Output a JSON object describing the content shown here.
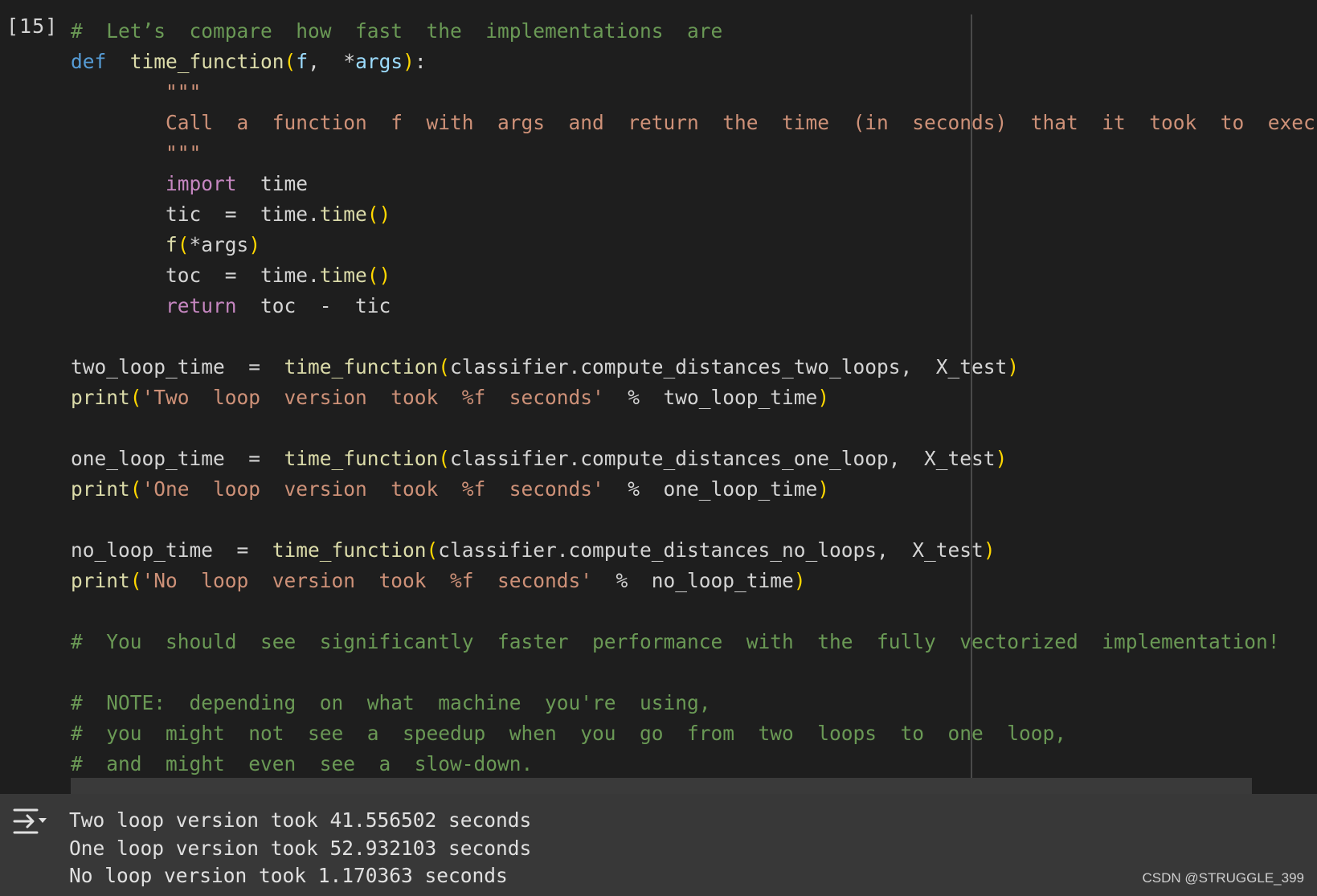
{
  "cell": {
    "execution_count": "[15]",
    "code_lines": [
      [
        [
          "cm",
          "#  Let’s  compare  how  fast  the  implementations  are"
        ]
      ],
      [
        [
          "kw",
          "def"
        ],
        [
          "t",
          "  "
        ],
        [
          "fn",
          "time_function"
        ],
        [
          "br",
          "("
        ],
        [
          "var",
          "f"
        ],
        [
          "t",
          ",  "
        ],
        [
          "t",
          "*"
        ],
        [
          "var",
          "args"
        ],
        [
          "br",
          ")"
        ],
        [
          "t",
          ":"
        ]
      ],
      [
        [
          "t",
          "        "
        ],
        [
          "str",
          "\"\"\""
        ]
      ],
      [
        [
          "t",
          "        "
        ],
        [
          "str",
          "Call  a  function  f  with  args  and  return  the  time  (in  seconds)  that  it  took  to  execute."
        ]
      ],
      [
        [
          "t",
          "        "
        ],
        [
          "str",
          "\"\"\""
        ]
      ],
      [
        [
          "t",
          "        "
        ],
        [
          "kw2",
          "import"
        ],
        [
          "t",
          "  time"
        ]
      ],
      [
        [
          "t",
          "        tic  =  time."
        ],
        [
          "fn",
          "time"
        ],
        [
          "br",
          "()"
        ]
      ],
      [
        [
          "t",
          "        "
        ],
        [
          "fn",
          "f"
        ],
        [
          "br",
          "("
        ],
        [
          "t",
          "*args"
        ],
        [
          "br",
          ")"
        ]
      ],
      [
        [
          "t",
          "        toc  =  time."
        ],
        [
          "fn",
          "time"
        ],
        [
          "br",
          "()"
        ]
      ],
      [
        [
          "t",
          "        "
        ],
        [
          "kw2",
          "return"
        ],
        [
          "t",
          "  toc  -  tic"
        ]
      ],
      [
        [
          "t",
          ""
        ]
      ],
      [
        [
          "t",
          "two_loop_time  =  "
        ],
        [
          "fn",
          "time_function"
        ],
        [
          "br",
          "("
        ],
        [
          "t",
          "classifier.compute_distances_two_loops,  X_test"
        ],
        [
          "br",
          ")"
        ]
      ],
      [
        [
          "fn",
          "print"
        ],
        [
          "br",
          "("
        ],
        [
          "str",
          "'Two  loop  version  took  %f  seconds'"
        ],
        [
          "t",
          "  %  two_loop_time"
        ],
        [
          "br",
          ")"
        ]
      ],
      [
        [
          "t",
          ""
        ]
      ],
      [
        [
          "t",
          "one_loop_time  =  "
        ],
        [
          "fn",
          "time_function"
        ],
        [
          "br",
          "("
        ],
        [
          "t",
          "classifier.compute_distances_one_loop,  X_test"
        ],
        [
          "br",
          ")"
        ]
      ],
      [
        [
          "fn",
          "print"
        ],
        [
          "br",
          "("
        ],
        [
          "str",
          "'One  loop  version  took  %f  seconds'"
        ],
        [
          "t",
          "  %  one_loop_time"
        ],
        [
          "br",
          ")"
        ]
      ],
      [
        [
          "t",
          ""
        ]
      ],
      [
        [
          "t",
          "no_loop_time  =  "
        ],
        [
          "fn",
          "time_function"
        ],
        [
          "br",
          "("
        ],
        [
          "t",
          "classifier.compute_distances_no_loops,  X_test"
        ],
        [
          "br",
          ")"
        ]
      ],
      [
        [
          "fn",
          "print"
        ],
        [
          "br",
          "("
        ],
        [
          "str",
          "'No  loop  version  took  %f  seconds'"
        ],
        [
          "t",
          "  %  no_loop_time"
        ],
        [
          "br",
          ")"
        ]
      ],
      [
        [
          "t",
          ""
        ]
      ],
      [
        [
          "cm",
          "#  You  should  see  significantly  faster  performance  with  the  fully  vectorized  implementation!"
        ]
      ],
      [
        [
          "t",
          ""
        ]
      ],
      [
        [
          "cm",
          "#  NOTE:  depending  on  what  machine  you're  using,"
        ]
      ],
      [
        [
          "cm",
          "#  you  might  not  see  a  speedup  when  you  go  from  two  loops  to  one  loop,"
        ]
      ],
      [
        [
          "cm",
          "#  and  might  even  see  a  slow-down."
        ]
      ]
    ]
  },
  "output": {
    "icon": "output-toggle-icon",
    "lines": [
      "Two loop version took 41.556502 seconds",
      "One loop version took 52.932103 seconds",
      "No loop version took 1.170363 seconds"
    ]
  },
  "watermark": "CSDN @STRUGGLE_399",
  "colors": {
    "background": "#1e1e1e",
    "comment": "#6a9955",
    "keyword": "#569cd6",
    "control_keyword": "#c586c0",
    "string": "#ce9178",
    "function": "#dcdcaa",
    "bracket": "#ffd700",
    "output_bg": "#383838"
  }
}
